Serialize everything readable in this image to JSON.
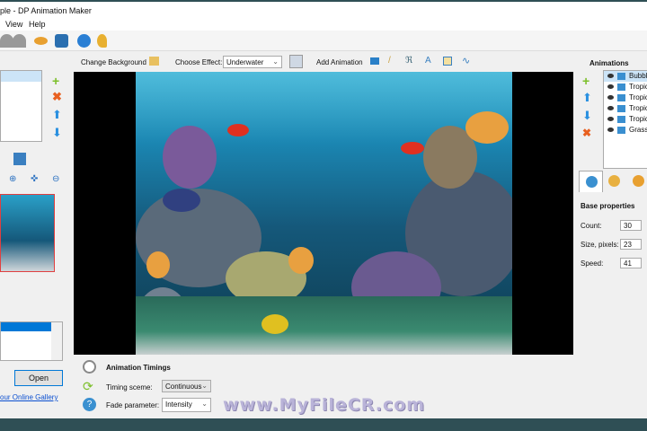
{
  "window": {
    "title": "ple - DP Animation Maker"
  },
  "menu": {
    "items": [
      "View",
      "Help"
    ]
  },
  "toolbar": {
    "icons": [
      "undo-icon",
      "redo-icon",
      "preview-eye-icon",
      "export-icon",
      "info-icon",
      "key-icon"
    ]
  },
  "effects_bar": {
    "change_background": "Change Background",
    "choose_effect_label": "Choose Effect:",
    "effect_value": "Underwater",
    "add_animation": "Add Animation"
  },
  "left": {
    "open_button": "Open",
    "gallery_link": "our Online Gallery"
  },
  "right": {
    "animations_title": "Animations",
    "animations": [
      "Bubbles",
      "Tropical",
      "Tropical",
      "Tropical",
      "Tropical",
      "Grass"
    ],
    "base_properties": "Base properties",
    "props": [
      {
        "label": "Count:",
        "value": "30"
      },
      {
        "label": "Size, pixels:",
        "value": "23"
      },
      {
        "label": "Speed:",
        "value": "41"
      }
    ]
  },
  "bottom": {
    "title": "Animation Timings",
    "timing_label": "Timing sceme:",
    "timing_value": "Continuous",
    "fade_label": "Fade parameter:",
    "fade_value": "Intensity"
  },
  "watermark": "www.MyFileCR.com",
  "colors": {
    "accent": "#0078d7",
    "status_bar": "#2f4f55",
    "water": "#1aa0c8"
  }
}
